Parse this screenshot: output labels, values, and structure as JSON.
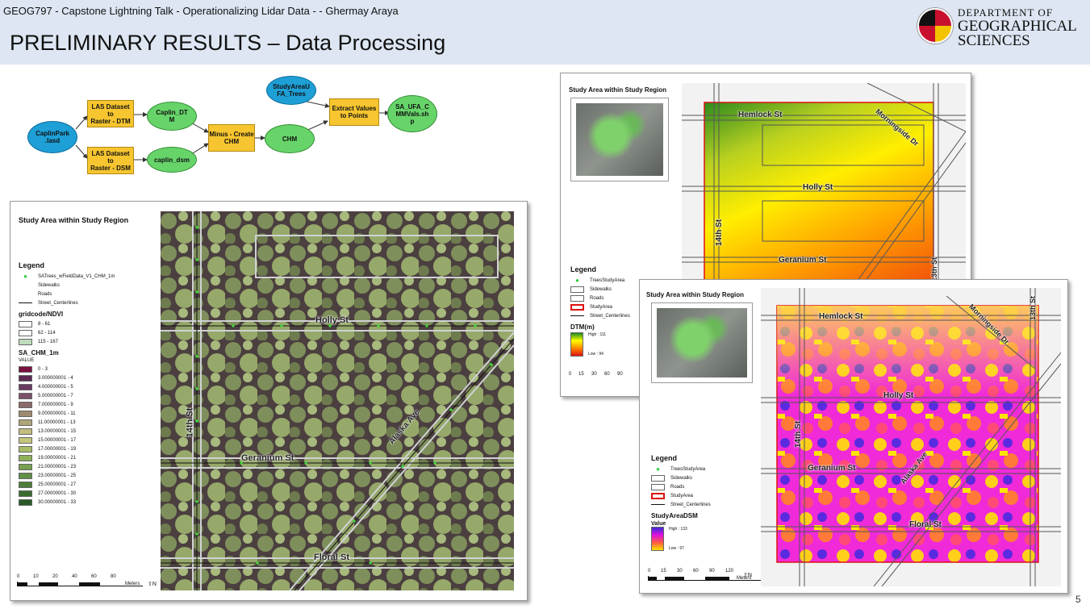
{
  "header": {
    "course_line": "GEOG797 - Capstone Lightning Talk -  Operationalizing Lidar Data -  - Ghermay Araya",
    "title": "PRELIMINARY RESULTS – Data Processing",
    "dept": {
      "line1": "DEPARTMENT OF",
      "line2": "GEOGRAPHICAL",
      "line3": "SCIENCES"
    },
    "band_color": "#dde6f2"
  },
  "model": {
    "input": "CaplinPark\n.lasd",
    "tool_dtm": "LAS Dataset to\nRaster - DTM",
    "tool_dsm": "LAS Dataset to\nRaster - DSM",
    "out_dtm": "Caplin_DT\nM",
    "out_dsm": "caplin_dsm",
    "tool_minus": "Minus - Create\nCHM",
    "out_chm": "CHM",
    "input_trees": "StudyAreaU\nFA_Trees",
    "tool_extract": "Extract Values\nto Points",
    "out_final": "SA_UFA_C\nMMVals.sh\np",
    "colors": {
      "data": "#1e9fd6",
      "tool": "#f6c52f",
      "output": "#67d46a"
    }
  },
  "left_map": {
    "title": "Study Area within Study Region",
    "legend_title": "Legend",
    "layers": [
      "SATrees_wFieldData_V1_CHM_1m",
      "Sidewalks",
      "Roads",
      "Street_Centerlines"
    ],
    "ndvi_title": "gridcode/NDVI",
    "ndvi_classes": [
      {
        "label": "8 - 61",
        "color": "#ffffff"
      },
      {
        "label": "62 - 114",
        "color": "#ffffff"
      },
      {
        "label": "115 - 167",
        "color": "#bfdcbc"
      }
    ],
    "chm_title": "SA_CHM_1m",
    "chm_value": "VALUE",
    "chm_classes": [
      {
        "label": "0 - 3",
        "color": "#7a1140"
      },
      {
        "label": "3.000000001 - 4",
        "color": "#5c2a55"
      },
      {
        "label": "4.000000001 - 5",
        "color": "#6a3a62"
      },
      {
        "label": "5.000000001 - 7",
        "color": "#7a5069"
      },
      {
        "label": "7.000000001 - 9",
        "color": "#8c6a6a"
      },
      {
        "label": "9.000000001 - 11",
        "color": "#9e8a70"
      },
      {
        "label": "11.00000001 - 13",
        "color": "#b0a579"
      },
      {
        "label": "13.00000001 - 15",
        "color": "#c2bd7e"
      },
      {
        "label": "15.00000001 - 17",
        "color": "#c5c77a"
      },
      {
        "label": "17.00000001 - 19",
        "color": "#a8bd66"
      },
      {
        "label": "19.00000001 - 21",
        "color": "#8fb05a"
      },
      {
        "label": "21.00000001 - 23",
        "color": "#78a04e"
      },
      {
        "label": "23.00000001 - 25",
        "color": "#609046"
      },
      {
        "label": "25.00000001 - 27",
        "color": "#4c7e3a"
      },
      {
        "label": "27.00000001 - 30",
        "color": "#3a6c30"
      },
      {
        "label": "30.00000001 - 33",
        "color": "#285a26"
      }
    ],
    "streets": [
      "Holly St",
      "14th St",
      "Geranium St",
      "Alaska Ave",
      "Floral St"
    ],
    "scale_labels": [
      "0",
      "10",
      "20",
      "40",
      "60",
      "80"
    ],
    "scale_unit": "Meters",
    "north": "N"
  },
  "dtm_map": {
    "title": "Study Area within Study Region",
    "legend_title": "Legend",
    "layers": [
      "TreesStudyArea",
      "Sidewalks",
      "Roads",
      "StudyArea",
      "Street_Centerlines"
    ],
    "ramp_title": "DTM(m)",
    "high": "High : 111",
    "low": "Low : 94",
    "streets": [
      "Hemlock St",
      "Morningside Dr",
      "Holly St",
      "14th St",
      "Geranium St",
      "13th St"
    ],
    "scale_labels": [
      "0",
      "15",
      "30",
      "60",
      "90"
    ]
  },
  "dsm_map": {
    "title": "Study Area within Study Region",
    "legend_title": "Legend",
    "layers": [
      "TreesStudyArea",
      "Sidewalks",
      "Roads",
      "StudyArea",
      "Street_Centerlines"
    ],
    "ramp_title": "StudyAreaDSM",
    "ramp_value": "Value",
    "high": "High : 133",
    "low": "Low : 97",
    "streets": [
      "Hemlock St",
      "Morningside Dr",
      "Holly St",
      "14th St",
      "Geranium St",
      "Alaska Ave",
      "Floral St",
      "13th St"
    ],
    "scale_labels": [
      "0",
      "15",
      "30",
      "60",
      "90",
      "120"
    ],
    "scale_unit": "Meters",
    "north": "N"
  },
  "page_number": "5"
}
